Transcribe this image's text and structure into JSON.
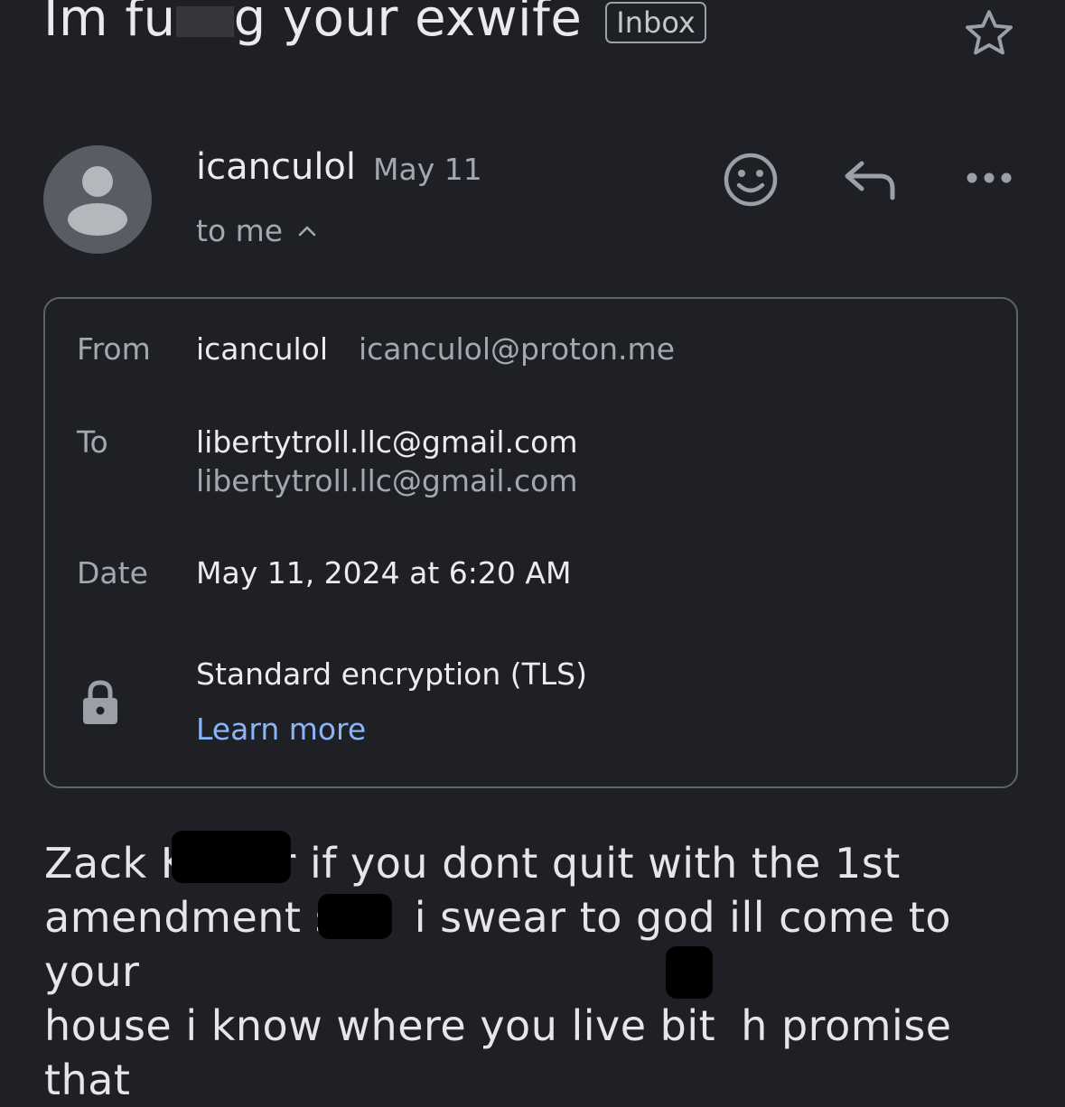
{
  "header": {
    "subject_part1": "Im fu",
    "subject_part2": "g your exwife",
    "label_chip": "Inbox",
    "star_icon": "star-outline-icon"
  },
  "sender": {
    "name": "icanculol",
    "date": "May 11",
    "recipient_summary": "to me",
    "avatar_icon": "person-icon"
  },
  "actions": {
    "emoji_icon": "emoji-smile-icon",
    "reply_icon": "reply-icon",
    "more_icon": "more-horizontal-icon"
  },
  "details": {
    "from_label": "From",
    "from_name": "icanculol",
    "from_email": "icanculol@proton.me",
    "to_label": "To",
    "to_primary": "libertytroll.llc@gmail.com",
    "to_secondary": "libertytroll.llc@gmail.com",
    "date_label": "Date",
    "date_value": "May 11, 2024 at 6:20 AM",
    "encryption_text": "Standard encryption (TLS)",
    "learn_more": "Learn more",
    "lock_icon": "lock-icon"
  },
  "body": {
    "line1_a": "Zack K",
    "line1_b": "r if you dont quit with the 1st",
    "line2_a": "amendment sh",
    "line2_b": "i swear to god ill come to your",
    "line3_a": "house i know where you live bit",
    "line3_b": "h promise that"
  },
  "colors": {
    "background": "#1f2025",
    "link": "#8ab4f8",
    "secondary_text": "#a4a8ae"
  }
}
